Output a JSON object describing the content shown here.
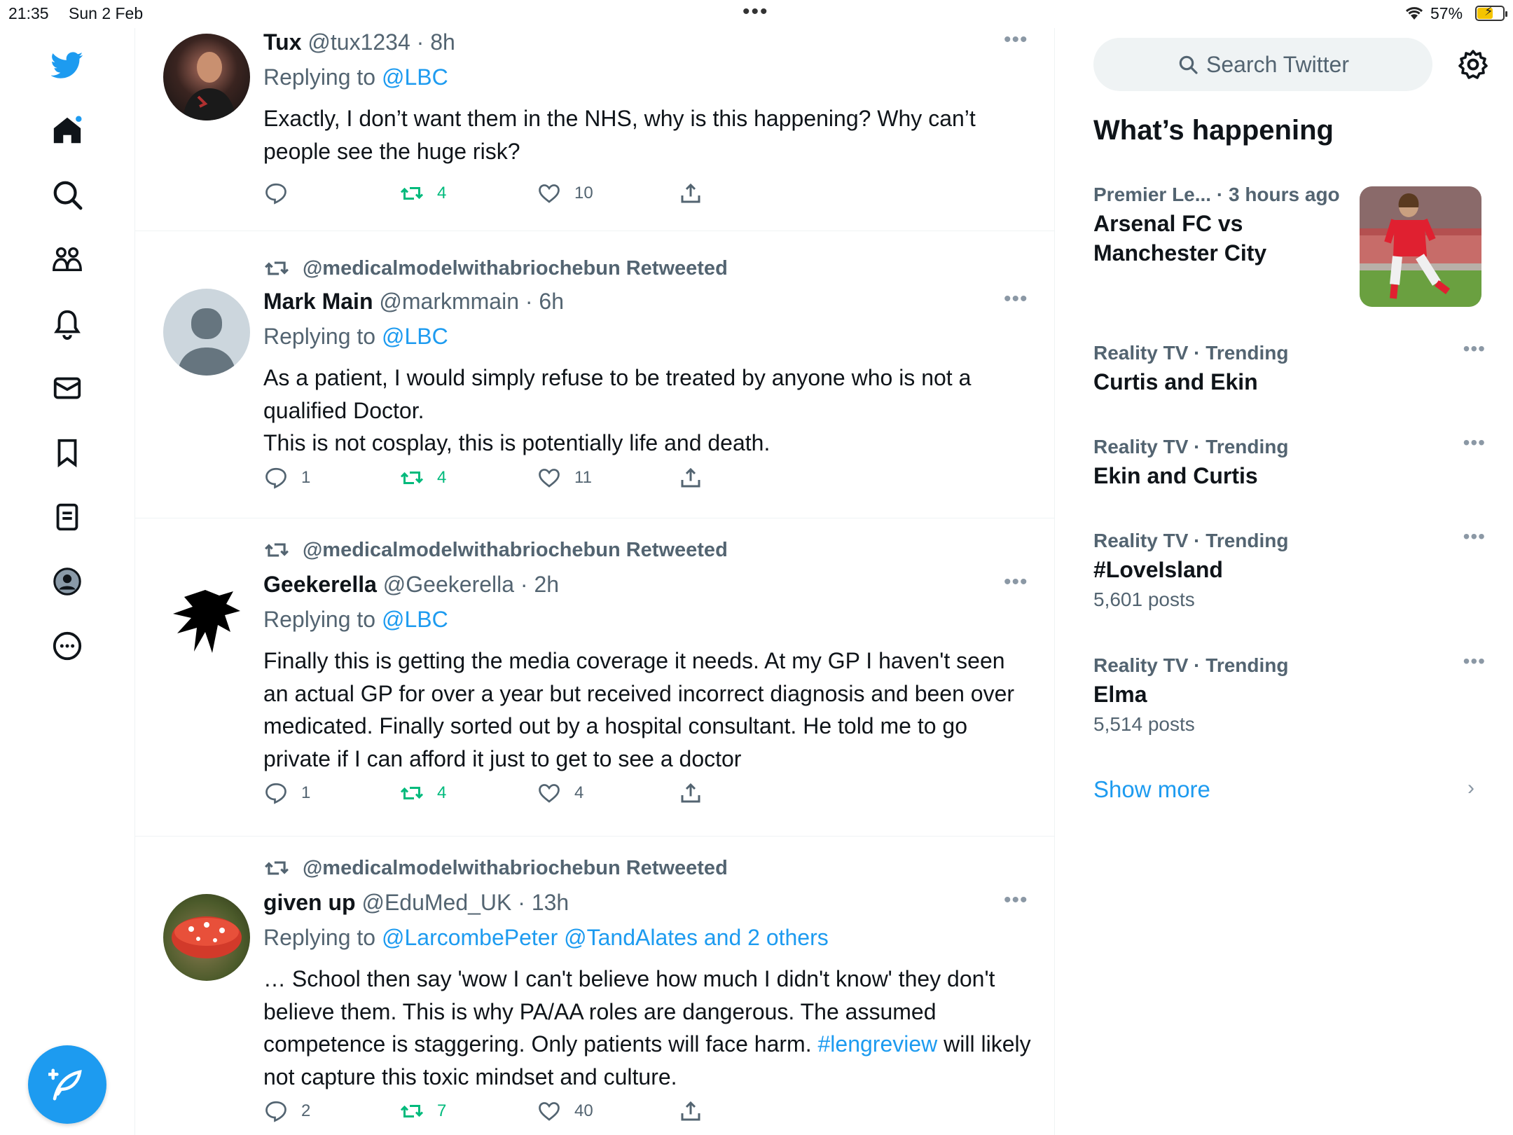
{
  "status_bar": {
    "time": "21:35",
    "date": "Sun 2 Feb",
    "battery": "57%"
  },
  "nav": {
    "icons": [
      "twitter-logo-icon",
      "home-icon",
      "explore-icon",
      "communities-icon",
      "notifications-icon",
      "messages-icon",
      "bookmarks-icon",
      "lists-icon",
      "profile-icon",
      "more-icon"
    ],
    "compose_icon": "compose-feather-icon"
  },
  "tweets": [
    {
      "retweeted_by": "",
      "name": "Tux",
      "meta": "@tux1234 · 8h",
      "replying_prefix": "Replying to ",
      "replying_to": "@LBC",
      "text": "Exactly, I don’t want them in the NHS, why is this happening? Why can’t people see the huge risk?",
      "replies": "",
      "retweets": "4",
      "likes": "10"
    },
    {
      "retweeted_by": "@medicalmodelwithabriochebun Retweeted",
      "name": "Mark Main",
      "meta": "@markmmain · 6h",
      "replying_prefix": "Replying to ",
      "replying_to": "@LBC",
      "text": "As a patient, I would simply refuse to be treated by anyone who is not a qualified Doctor.\nThis is not cosplay, this is potentially life and death.",
      "replies": "1",
      "retweets": "4",
      "likes": "11"
    },
    {
      "retweeted_by": "@medicalmodelwithabriochebun Retweeted",
      "name": "Geekerella",
      "meta": "@Geekerella · 2h",
      "replying_prefix": "Replying to ",
      "replying_to": "@LBC",
      "text": "Finally this is getting the media coverage it needs. At my GP I haven't seen an actual GP for over a year but received incorrect diagnosis and been over medicated. Finally sorted out by a hospital consultant. He told me to go private if I can afford it just to get to see a doctor",
      "replies": "1",
      "retweets": "4",
      "likes": "4"
    },
    {
      "retweeted_by": "@medicalmodelwithabriochebun Retweeted",
      "name": "given up",
      "meta": "@EduMed_UK · 13h",
      "replying_prefix": "Replying to ",
      "replying_to": "@LarcombePeter @TandAlates and 2 others",
      "text_main": "… School then say 'wow I can't believe how much I didn't know' they don't believe them. This is why PA/AA roles are dangerous. The assumed competence is staggering. Only patients will face harm. ",
      "hashtag": "#lengreview",
      "text_end": " will likely not capture this toxic mindset and culture.",
      "replies": "2",
      "retweets": "7",
      "likes": "40"
    }
  ],
  "sidebar": {
    "search_placeholder": "Search Twitter",
    "whats_happening": "What’s happening",
    "trends": [
      {
        "context": "Premier Le... · 3 hours ago",
        "title": "Arsenal FC vs Manchester City",
        "posts": ""
      },
      {
        "context": "Reality TV · Trending",
        "title": "Curtis and Ekin",
        "posts": ""
      },
      {
        "context": "Reality TV · Trending",
        "title": "Ekin and Curtis",
        "posts": ""
      },
      {
        "context": "Reality TV · Trending",
        "title": "#LoveIsland",
        "posts": "5,601 posts"
      },
      {
        "context": "Reality TV · Trending",
        "title": "Elma",
        "posts": "5,514 posts"
      }
    ],
    "show_more": "Show more"
  },
  "colors": {
    "accent": "#1d9bf0",
    "retweet": "#00ba7c",
    "muted": "#536471",
    "text": "#0f1419"
  }
}
